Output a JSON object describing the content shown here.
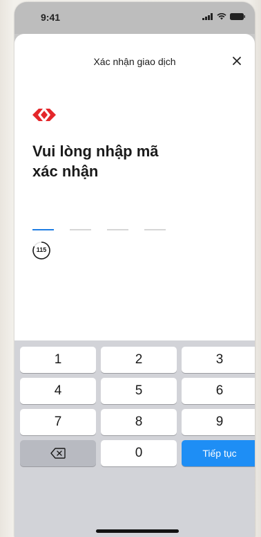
{
  "status_bar": {
    "time": "9:41"
  },
  "header": {
    "title": "Xác nhận giao dịch",
    "close_icon": "close-icon"
  },
  "brand": {
    "logo_icon": "techcombank-diamond-logo",
    "logo_color": "#e4262a"
  },
  "prompt": {
    "line1": "Vui lòng nhập mã",
    "line2": "xác nhận"
  },
  "otp": {
    "length": 4,
    "active_index": 0,
    "active_color": "#1e7de3"
  },
  "timer": {
    "seconds": "115"
  },
  "keyboard": {
    "keys": [
      "1",
      "2",
      "3",
      "4",
      "5",
      "6",
      "7",
      "8",
      "9"
    ],
    "zero": "0",
    "backspace_icon": "backspace-icon",
    "continue_label": "Tiếp tục",
    "continue_color": "#1e8ef5"
  }
}
